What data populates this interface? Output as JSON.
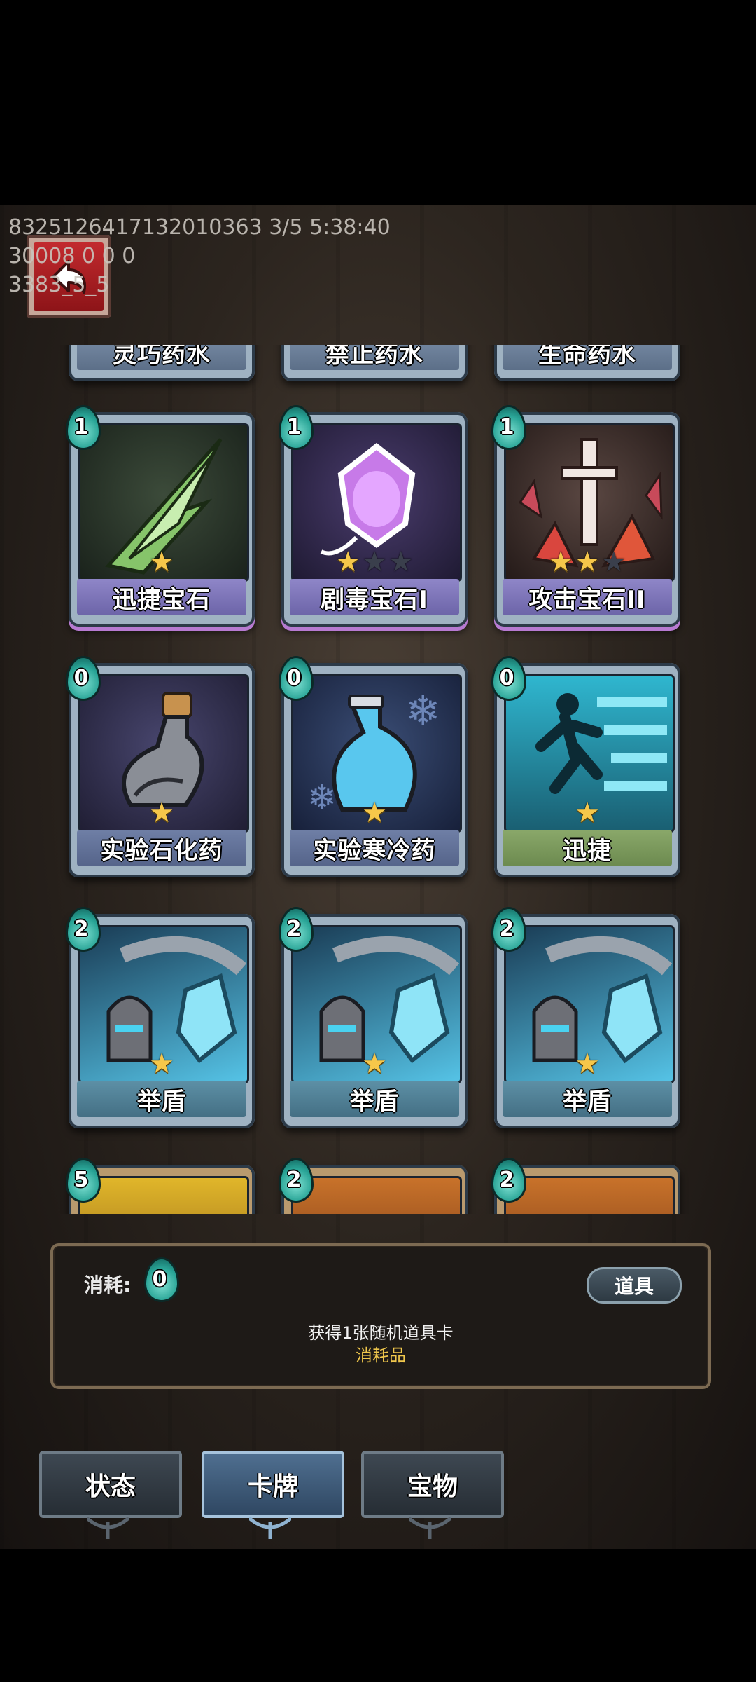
{
  "debug": {
    "line1": "8325126417132010363 3/5 5:38:40",
    "line2": "30008 0 0 0",
    "line3": "3383_5_5"
  },
  "top_row": [
    "灵巧药水",
    "禁止药水",
    "生命药水"
  ],
  "cards": [
    {
      "name": "迅捷宝石",
      "cost": "1",
      "stars": 1,
      "max_stars": 1,
      "type": "gem",
      "art": "green-crystal-icon"
    },
    {
      "name": "剧毒宝石I",
      "cost": "1",
      "stars": 1,
      "max_stars": 3,
      "type": "gem",
      "art": "purple-gem-icon"
    },
    {
      "name": "攻击宝石II",
      "cost": "1",
      "stars": 2,
      "max_stars": 3,
      "type": "gem",
      "art": "red-sword-gem-icon"
    },
    {
      "name": "实验石化药",
      "cost": "0",
      "stars": 1,
      "max_stars": 1,
      "type": "potion",
      "art": "gray-potion-icon"
    },
    {
      "name": "实验寒冷药",
      "cost": "0",
      "stars": 1,
      "max_stars": 1,
      "type": "potion",
      "art": "blue-potion-icon"
    },
    {
      "name": "迅捷",
      "cost": "0",
      "stars": 1,
      "max_stars": 1,
      "type": "skill",
      "art": "running-figure-icon"
    },
    {
      "name": "举盾",
      "cost": "2",
      "stars": 1,
      "max_stars": 1,
      "type": "shield",
      "art": "knight-shield-icon"
    },
    {
      "name": "举盾",
      "cost": "2",
      "stars": 1,
      "max_stars": 1,
      "type": "shield",
      "art": "knight-shield-icon"
    },
    {
      "name": "举盾",
      "cost": "2",
      "stars": 1,
      "max_stars": 1,
      "type": "shield",
      "art": "knight-shield-icon"
    }
  ],
  "bottom_row_costs": [
    "5",
    "2",
    "2"
  ],
  "info": {
    "cost_label": "消耗:",
    "cost_value": "0",
    "tag": "道具",
    "description": "获得1张随机道具卡",
    "type_text": "消耗品"
  },
  "tabs": [
    "状态",
    "卡牌",
    "宝物"
  ],
  "active_tab": "卡牌",
  "colors": {
    "cost_drop": "#2aa597",
    "star": "#f6c74a",
    "type_text": "#f0c74c"
  }
}
